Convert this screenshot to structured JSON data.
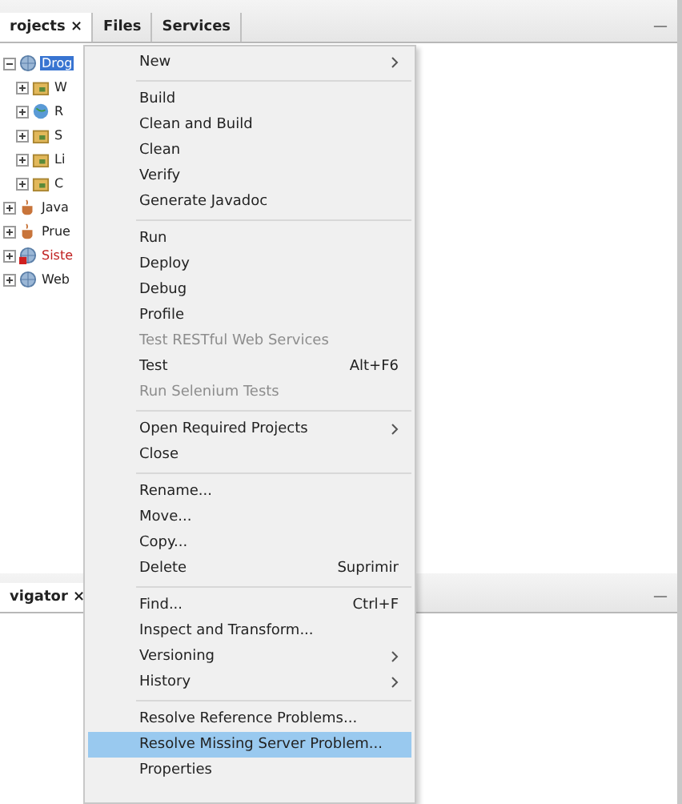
{
  "projects_panel": {
    "tabs": [
      {
        "label": "rojects ×",
        "selected": true
      },
      {
        "label": "Files",
        "selected": false
      },
      {
        "label": "Services",
        "selected": false
      }
    ],
    "minimize": "—",
    "tree": [
      {
        "label": "Drog",
        "kind": "web",
        "selected": true,
        "expanded": true,
        "error": false,
        "children": [
          {
            "label": "W",
            "kind": "folder",
            "selected": false,
            "expanded": false,
            "error": false
          },
          {
            "label": "R",
            "kind": "globe",
            "selected": false,
            "expanded": false,
            "error": false
          },
          {
            "label": "S",
            "kind": "folder",
            "selected": false,
            "expanded": false,
            "error": false
          },
          {
            "label": "Li",
            "kind": "folder",
            "selected": false,
            "expanded": false,
            "error": false
          },
          {
            "label": "C",
            "kind": "folder",
            "selected": false,
            "expanded": false,
            "error": false
          }
        ]
      },
      {
        "label": "Java",
        "kind": "cup",
        "selected": false,
        "expanded": false,
        "error": false
      },
      {
        "label": "Prue",
        "kind": "cup",
        "selected": false,
        "expanded": false,
        "error": false
      },
      {
        "label": "Siste",
        "kind": "web",
        "selected": false,
        "expanded": false,
        "error": true
      },
      {
        "label": "Web",
        "kind": "web",
        "selected": false,
        "expanded": false,
        "error": false
      }
    ]
  },
  "navigator_panel": {
    "tab": "vigator ×",
    "minimize": "—"
  },
  "context_menu": [
    [
      {
        "label": "New",
        "has_submenu": true,
        "disabled": false,
        "selected": false
      }
    ],
    [
      {
        "label": "Build",
        "has_submenu": false,
        "disabled": false,
        "selected": false
      },
      {
        "label": "Clean and Build",
        "has_submenu": false,
        "disabled": false,
        "selected": false
      },
      {
        "label": "Clean",
        "has_submenu": false,
        "disabled": false,
        "selected": false
      },
      {
        "label": "Verify",
        "has_submenu": false,
        "disabled": false,
        "selected": false
      },
      {
        "label": "Generate Javadoc",
        "has_submenu": false,
        "disabled": false,
        "selected": false
      }
    ],
    [
      {
        "label": "Run",
        "has_submenu": false,
        "disabled": false,
        "selected": false
      },
      {
        "label": "Deploy",
        "has_submenu": false,
        "disabled": false,
        "selected": false
      },
      {
        "label": "Debug",
        "has_submenu": false,
        "disabled": false,
        "selected": false
      },
      {
        "label": "Profile",
        "has_submenu": false,
        "disabled": false,
        "selected": false
      },
      {
        "label": "Test RESTful Web Services",
        "has_submenu": false,
        "disabled": true,
        "selected": false
      },
      {
        "label": "Test",
        "shortcut": "Alt+F6",
        "has_submenu": false,
        "disabled": false,
        "selected": false
      },
      {
        "label": "Run Selenium Tests",
        "has_submenu": false,
        "disabled": true,
        "selected": false
      }
    ],
    [
      {
        "label": "Open Required Projects",
        "has_submenu": true,
        "disabled": false,
        "selected": false
      },
      {
        "label": "Close",
        "has_submenu": false,
        "disabled": false,
        "selected": false
      }
    ],
    [
      {
        "label": "Rename...",
        "has_submenu": false,
        "disabled": false,
        "selected": false
      },
      {
        "label": "Move...",
        "has_submenu": false,
        "disabled": false,
        "selected": false
      },
      {
        "label": "Copy...",
        "has_submenu": false,
        "disabled": false,
        "selected": false
      },
      {
        "label": "Delete",
        "shortcut": "Suprimir",
        "has_submenu": false,
        "disabled": false,
        "selected": false
      }
    ],
    [
      {
        "label": "Find...",
        "shortcut": "Ctrl+F",
        "has_submenu": false,
        "disabled": false,
        "selected": false
      },
      {
        "label": "Inspect and Transform...",
        "has_submenu": false,
        "disabled": false,
        "selected": false
      },
      {
        "label": "Versioning",
        "has_submenu": true,
        "disabled": false,
        "selected": false
      },
      {
        "label": "History",
        "has_submenu": true,
        "disabled": false,
        "selected": false
      }
    ],
    [
      {
        "label": "Resolve Reference Problems...",
        "has_submenu": false,
        "disabled": false,
        "selected": false
      },
      {
        "label": "Resolve Missing Server Problem...",
        "has_submenu": false,
        "disabled": false,
        "selected": true
      },
      {
        "label": "Properties",
        "has_submenu": false,
        "disabled": false,
        "selected": false
      }
    ]
  ]
}
